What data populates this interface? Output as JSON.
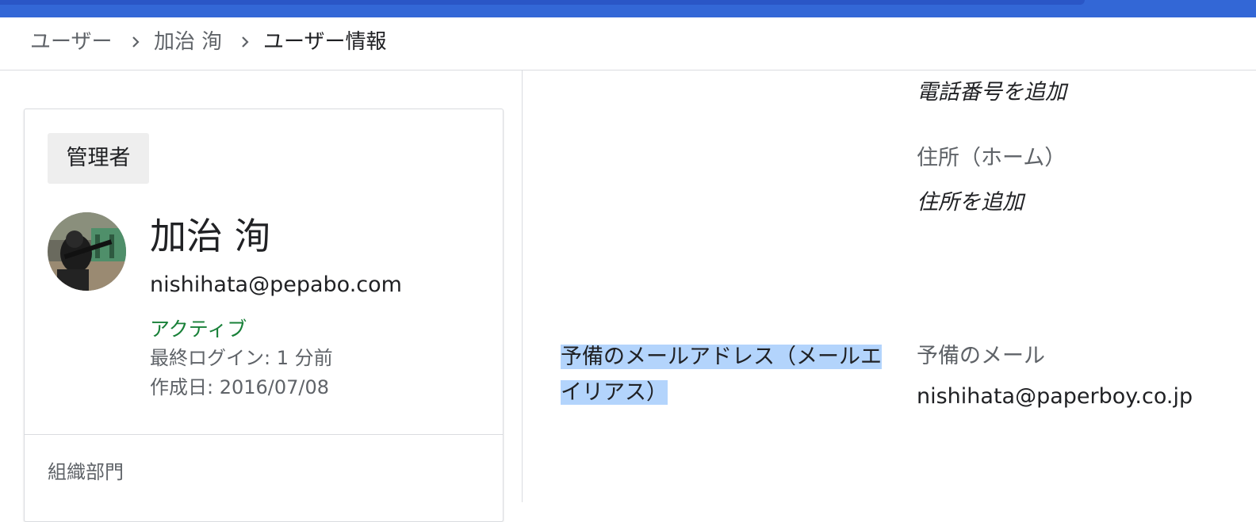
{
  "breadcrumb": {
    "items": [
      "ユーザー",
      "加治 洵",
      "ユーザー情報"
    ]
  },
  "user_card": {
    "role_badge": "管理者",
    "name": "加治 洵",
    "email": "nishihata@pepabo.com",
    "status": "アクティブ",
    "last_login": "最終ログイン: 1 分前",
    "created": "作成日: 2016/07/08",
    "org_unit_label": "組織部門"
  },
  "contact": {
    "phone_add": "電話番号を追加",
    "address_label": "住所（ホーム）",
    "address_add": "住所を追加"
  },
  "secondary_email_section": {
    "title": "予備のメールアドレス（メールエイリアス）",
    "label": "予備のメール",
    "value": "nishihata@paperboy.co.jp"
  },
  "colors": {
    "header_blue": "#3367d6",
    "status_green": "#188038",
    "selection_highlight": "#b3d4fc"
  },
  "icons": {
    "breadcrumb_separator": "chevron-right-icon",
    "avatar": "user-avatar-photo"
  }
}
